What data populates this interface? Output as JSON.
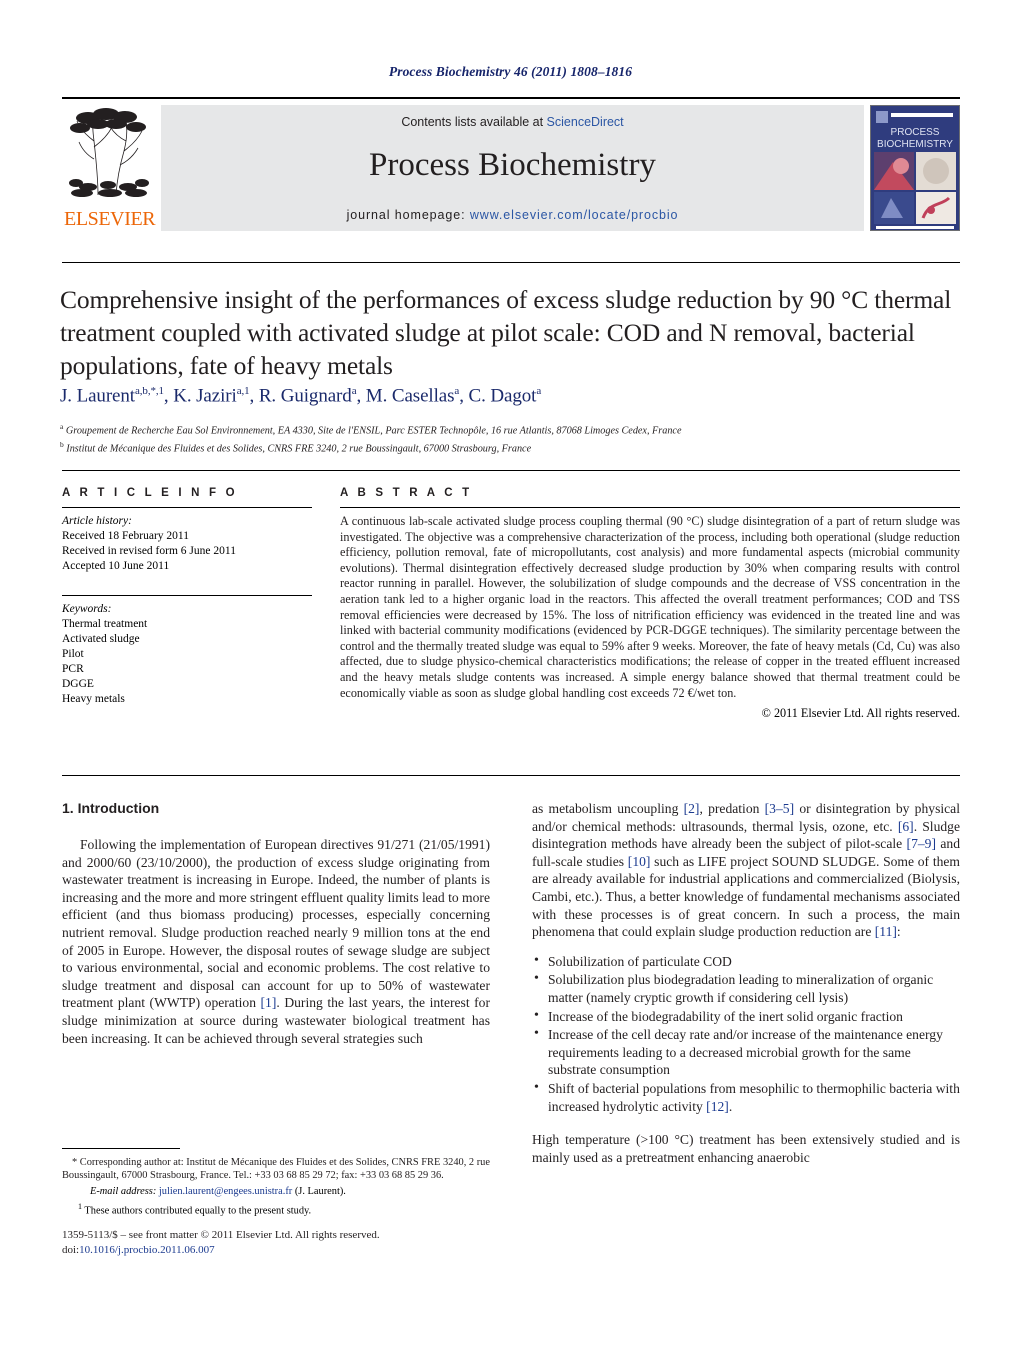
{
  "running_head": "Process Biochemistry 46 (2011) 1808–1816",
  "masthead": {
    "contents_prefix": "Contents lists available at ",
    "sciencedirect": "ScienceDirect",
    "journal_title": "Process Biochemistry",
    "homepage_prefix": "journal homepage: ",
    "homepage_url": "www.elsevier.com/locate/procbio",
    "publisher": "ELSEVIER",
    "cover_line1": "PROCESS",
    "cover_line2": "BIOCHEMISTRY",
    "accent_orange": "#ec6608",
    "accent_blue": "#2b56a4",
    "band_gray": "#e6e7e8"
  },
  "article": {
    "title": "Comprehensive insight of the performances of excess sludge reduction by 90 °C thermal treatment coupled with activated sludge at pilot scale: COD and N removal, bacterial populations, fate of heavy metals",
    "authors_html": "J. Laurent<sup>a,b,*,1</sup>, K. Jaziri<sup>a,1</sup>, R. Guignard<sup>a</sup>, M. Casellas<sup>a</sup>, C. Dagot<sup>a</sup>",
    "affiliation_a": "Groupement de Recherche Eau Sol Environnement, EA 4330, Site de l'ENSIL, Parc ESTER Technopôle, 16 rue Atlantis, 87068 Limoges Cedex, France",
    "affiliation_b": "Institut de Mécanique des Fluides et des Solides, CNRS FRE 3240, 2 rue Boussingault, 67000 Strasbourg, France"
  },
  "article_info": {
    "heading": "A R T I C L E    I N F O",
    "history_label": "Article history:",
    "history": [
      "Received 18 February 2011",
      "Received in revised form 6 June 2011",
      "Accepted 10 June 2011"
    ],
    "keywords_label": "Keywords:",
    "keywords": [
      "Thermal treatment",
      "Activated sludge",
      "Pilot",
      "PCR",
      "DGGE",
      "Heavy metals"
    ]
  },
  "abstract": {
    "heading": "A B S T R A C T",
    "text": "A continuous lab-scale activated sludge process coupling thermal (90 °C) sludge disintegration of a part of return sludge was investigated. The objective was a comprehensive characterization of the process, including both operational (sludge reduction efficiency, pollution removal, fate of micropollutants, cost analysis) and more fundamental aspects (microbial community evolutions). Thermal disintegration effectively decreased sludge production by 30% when comparing results with control reactor running in parallel. However, the solubilization of sludge compounds and the decrease of VSS concentration in the aeration tank led to a higher organic load in the reactors. This affected the overall treatment performances; COD and TSS removal efficiencies were decreased by 15%. The loss of nitrification efficiency was evidenced in the treated line and was linked with bacterial community modifications (evidenced by PCR-DGGE techniques). The similarity percentage between the control and the thermally treated sludge was equal to 59% after 9 weeks. Moreover, the fate of heavy metals (Cd, Cu) was also affected, due to sludge physico-chemical characteristics modifications; the release of copper in the treated effluent increased and the heavy metals sludge contents was increased. A simple energy balance showed that thermal treatment could be economically viable as soon as sludge global handling cost exceeds 72 €/wet ton.",
    "copyright": "© 2011 Elsevier Ltd. All rights reserved."
  },
  "body": {
    "section_number_title": "1.  Introduction",
    "left_paragraphs": [
      "Following the implementation of European directives 91/271 (21/05/1991) and 2000/60 (23/10/2000), the production of excess sludge originating from wastewater treatment is increasing in Europe. Indeed, the number of plants is increasing and the more and more stringent effluent quality limits lead to more efficient (and thus biomass producing) processes, especially concerning nutrient removal. Sludge production reached nearly 9 million tons at the end of 2005 in Europe. However, the disposal routes of sewage sludge are subject to various environmental, social and economic problems. The cost relative to sludge treatment and disposal can account for up to 50% of wastewater treatment plant (WWTP) operation [1]. During the last years, the interest for sludge minimization at source during wastewater biological treatment has been increasing. It can be achieved through several strategies such"
    ],
    "right_paragraph_1": "as metabolism uncoupling [2], predation [3–5] or disintegration by physical and/or chemical methods: ultrasounds, thermal lysis, ozone, etc. [6]. Sludge disintegration methods have already been the subject of pilot-scale [7–9] and full-scale studies [10] such as LIFE project SOUND SLUDGE. Some of them are already available for industrial applications and commercialized (Biolysis, Cambi, etc.). Thus, a better knowledge of fundamental mechanisms associated with these processes is of great concern. In such a process, the main phenomena that could explain sludge production reduction are [11]:",
    "bullets": [
      "Solubilization of particulate COD",
      "Solubilization plus biodegradation leading to mineralization of organic matter (namely cryptic growth if considering cell lysis)",
      "Increase of the biodegradability of the inert solid organic fraction",
      "Increase of the cell decay rate and/or increase of the maintenance energy requirements leading to a decreased microbial growth for the same substrate consumption",
      "Shift of bacterial populations from mesophilic to thermophilic bacteria with increased hydrolytic activity [12]."
    ],
    "right_paragraph_2": "High temperature (>100 °C) treatment has been extensively studied and is mainly used as a pretreatment enhancing anaerobic"
  },
  "footnotes": {
    "corresponding": "* Corresponding author at: Institut de Mécanique des Fluides et des Solides, CNRS FRE 3240, 2 rue Boussingault, 67000 Strasbourg, France. Tel.: +33 03 68 85 29 72; fax: +33 03 68 85 29 36.",
    "email_label": "E-mail address:",
    "email_address": "julien.laurent@engees.unistra.fr",
    "email_suffix": "(J. Laurent).",
    "equal_contrib_marker": "1",
    "equal_contrib": "These authors contributed equally to the present study."
  },
  "imprint": {
    "issn_line": "1359-5113/$ – see front matter © 2011 Elsevier Ltd. All rights reserved.",
    "doi_label": "doi:",
    "doi": "10.1016/j.procbio.2011.06.007"
  }
}
